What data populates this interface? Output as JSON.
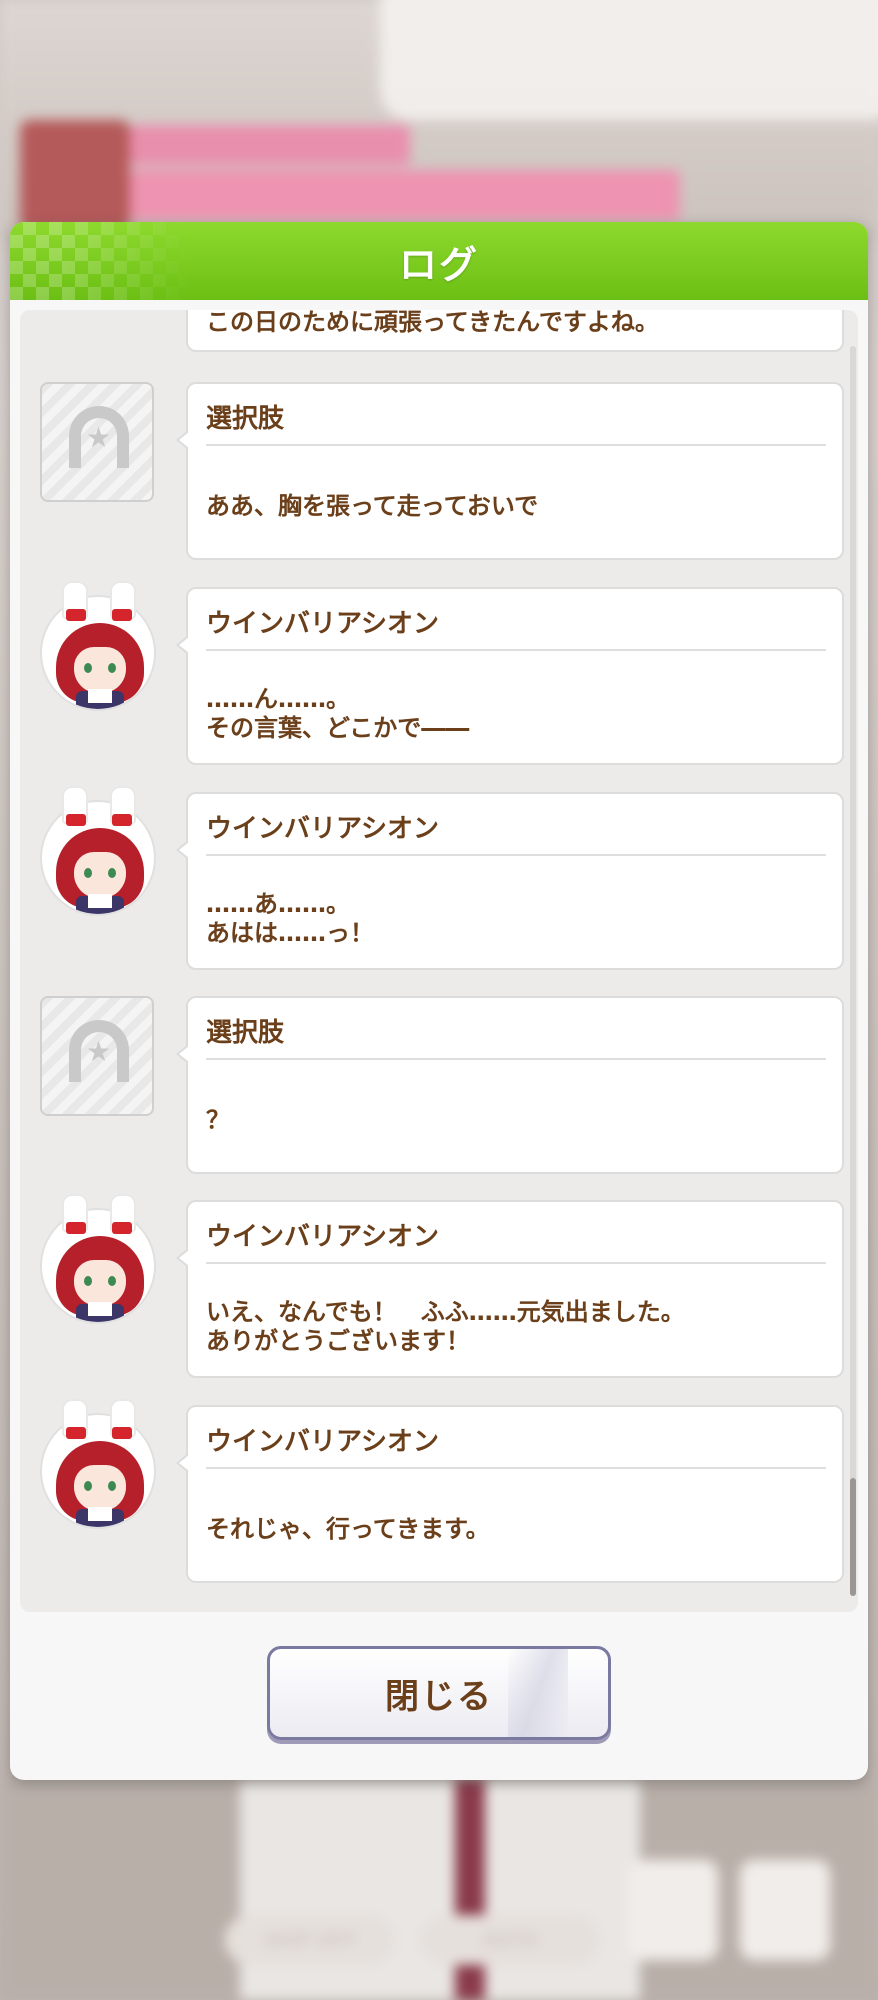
{
  "background": {
    "skip_label": "SKIP OFF",
    "auto_label": "AUTO"
  },
  "modal": {
    "title": "ログ",
    "partial_text": "この日のために頑張ってきたんですよね。",
    "entries": [
      {
        "speaker": "選択肢",
        "text": "ああ、胸を張って走っておいで",
        "avatar": "choice-horseshoe"
      },
      {
        "speaker": "ウインバリアシオン",
        "text": "……ん……。\nその言葉、どこかで――",
        "avatar": "character"
      },
      {
        "speaker": "ウインバリアシオン",
        "text": "……あ……。\nあはは……っ！",
        "avatar": "character"
      },
      {
        "speaker": "選択肢",
        "text": "？",
        "avatar": "choice-horseshoe"
      },
      {
        "speaker": "ウインバリアシオン",
        "text": "いえ、なんでも！　ふふ……元気出ました。\nありがとうございます！",
        "avatar": "character"
      },
      {
        "speaker": "ウインバリアシオン",
        "text": "それじゃ、行ってきます。",
        "avatar": "character"
      }
    ],
    "close_label": "閉じる"
  },
  "colors": {
    "header_green": "#7ccc20",
    "text_brown": "#6a3f1a"
  }
}
